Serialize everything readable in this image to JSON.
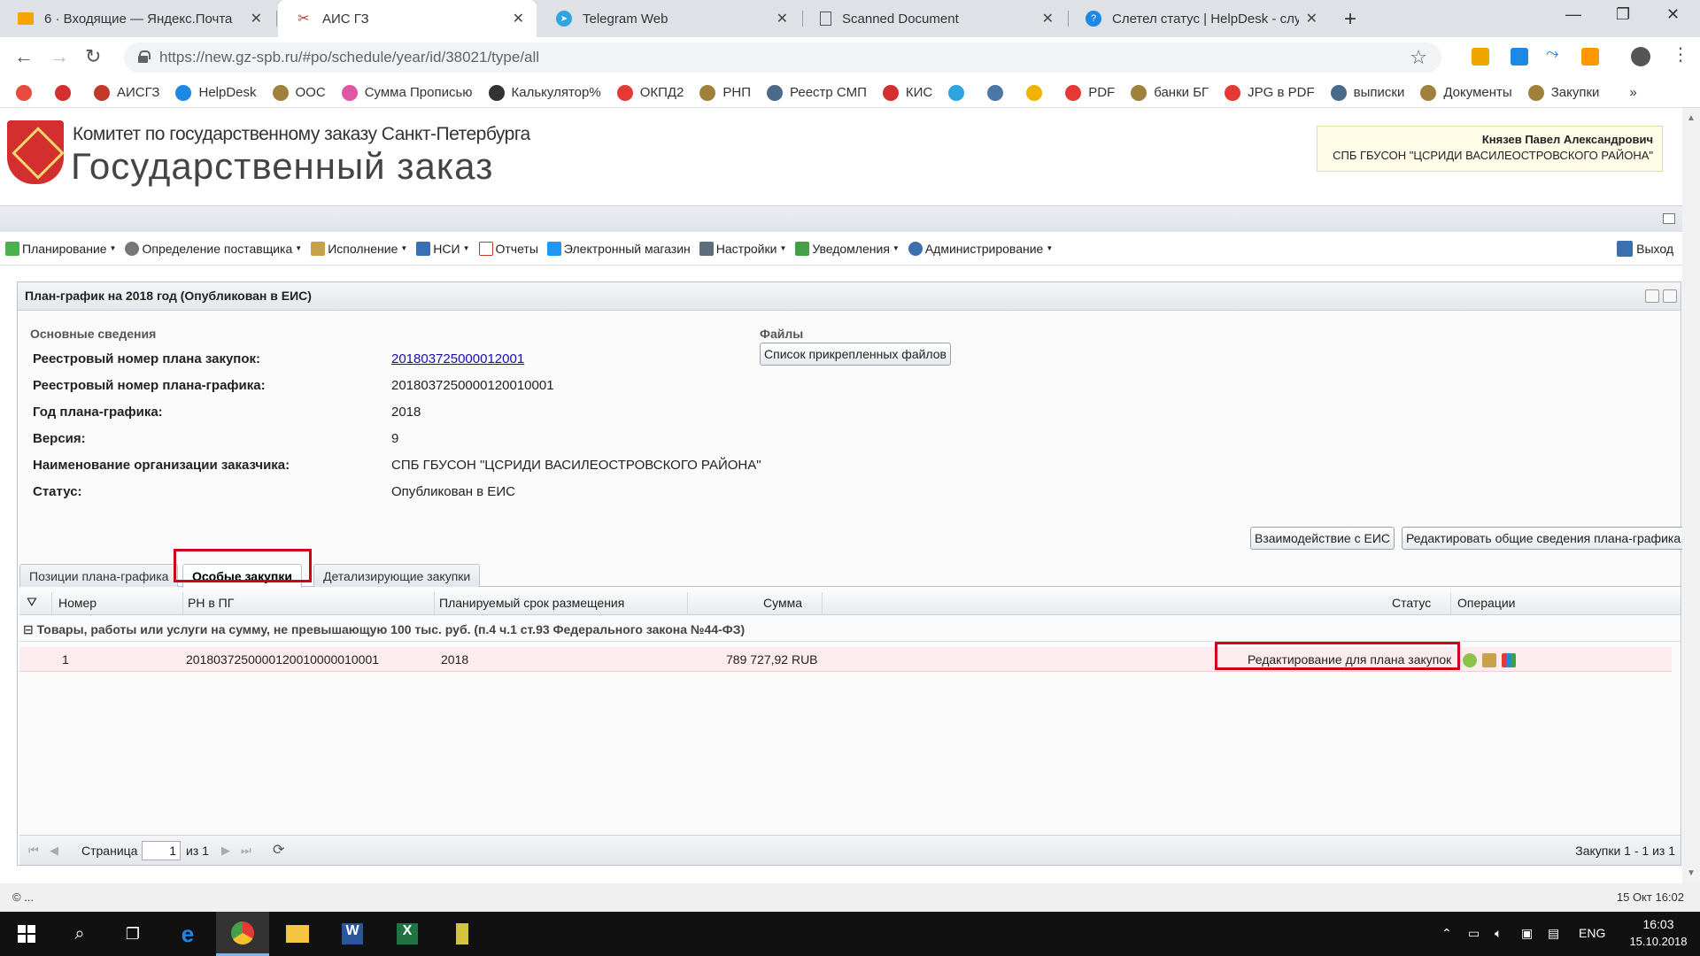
{
  "browser": {
    "tabs": [
      {
        "label": "6 · Входящие — Яндекс.Почта",
        "icon": "mail-icon"
      },
      {
        "label": "АИС ГЗ",
        "icon": "tools-icon"
      },
      {
        "label": "Telegram Web",
        "icon": "telegram-icon"
      },
      {
        "label": "Scanned Document",
        "icon": "document-icon"
      },
      {
        "label": "Слетел статус | HelpDesk - служ",
        "icon": "helpdesk-icon"
      }
    ],
    "url": "https://new.gz-spb.ru/#po/schedule/year/id/38021/type/all"
  },
  "bookmarks": [
    {
      "label": "",
      "color": "#e74c3c"
    },
    {
      "label": "",
      "color": "#d32f2f"
    },
    {
      "label": "АИСГЗ",
      "color": "#c0392b"
    },
    {
      "label": "HelpDesk",
      "color": "#1e88e5"
    },
    {
      "label": "ООС",
      "color": "#a0813c"
    },
    {
      "label": "Сумма Прописью",
      "color": "#e056a5"
    },
    {
      "label": "Калькулятор%",
      "color": "#333333"
    },
    {
      "label": "ОКПД2",
      "color": "#e53935"
    },
    {
      "label": "РНП",
      "color": "#a0813c"
    },
    {
      "label": "Реестр СМП",
      "color": "#4b6a8a"
    },
    {
      "label": "КИС",
      "color": "#d32f2f"
    },
    {
      "label": "",
      "color": "#2ca5e0"
    },
    {
      "label": "",
      "color": "#4a76a8"
    },
    {
      "label": "",
      "color": "#f0b400"
    },
    {
      "label": "PDF",
      "color": "#e53935"
    },
    {
      "label": "банки БГ",
      "color": "#a0813c"
    },
    {
      "label": "JPG в PDF",
      "color": "#e53935"
    },
    {
      "label": "выписки",
      "color": "#4b6a8a"
    },
    {
      "label": "Документы",
      "color": "#a0813c"
    },
    {
      "label": "Закупки",
      "color": "#a0813c"
    }
  ],
  "header": {
    "committee": "Комитет по государственному заказу Санкт-Петербурга",
    "title": "Государственный заказ",
    "user_name": "Князев Павел Александрович",
    "user_org": "СПБ ГБУСОН \"ЦСРИДИ ВАСИЛЕОСТРОВСКОГО РАЙОНА\""
  },
  "menu": [
    {
      "label": "Планирование",
      "dropdown": true,
      "color": "#4caf50"
    },
    {
      "label": "Определение поставщика",
      "dropdown": true,
      "color": "#777777"
    },
    {
      "label": "Исполнение",
      "dropdown": true,
      "color": "#c8a24a"
    },
    {
      "label": "НСИ",
      "dropdown": true,
      "color": "#3a6fb0"
    },
    {
      "label": "Отчеты",
      "dropdown": false,
      "color": "#c0392b"
    },
    {
      "label": "Электронный магазин",
      "dropdown": false,
      "color": "#2196f3"
    },
    {
      "label": "Настройки",
      "dropdown": true,
      "color": "#5d6d7e"
    },
    {
      "label": "Уведомления",
      "dropdown": true,
      "color": "#43a047"
    },
    {
      "label": "Администрирование",
      "dropdown": true,
      "color": "#3a6fb0"
    }
  ],
  "logout_label": "Выход",
  "panel": {
    "title": "План-график на 2018 год (Опубликован в ЕИС)",
    "section_title": "Основные сведения",
    "files_title": "Файлы",
    "files_button": "Список прикрепленных файлов",
    "fields": [
      {
        "label": "Реестровый номер плана закупок:",
        "value": "201803725000012001",
        "link": true
      },
      {
        "label": "Реестровый номер плана-графика:",
        "value": "2018037250000120010001",
        "link": false
      },
      {
        "label": "Год плана-графика:",
        "value": "2018",
        "link": false
      },
      {
        "label": "Версия:",
        "value": "9",
        "link": false
      },
      {
        "label": "Наименование организации заказчика:",
        "value": "СПБ ГБУСОН \"ЦСРИДИ ВАСИЛЕОСТРОВСКОГО РАЙОНА\"",
        "link": false
      },
      {
        "label": "Статус:",
        "value": "Опубликован в ЕИС",
        "link": false
      }
    ],
    "btn_eis": "Взаимодействие с ЕИС",
    "btn_edit": "Редактировать общие сведения плана-графика",
    "tabs": [
      "Позиции плана-графика",
      "Особые закупки",
      "Детализирующие закупки"
    ],
    "active_tab": 1,
    "columns": [
      "Номер",
      "РН в ПГ",
      "Планируемый срок размещения",
      "Сумма",
      "Статус",
      "Операции"
    ],
    "group": "Товары, работы или услуги на сумму, не превышающую 100 тыс. руб. (п.4 ч.1 ст.93 Федерального закона №44-ФЗ)",
    "rows": [
      {
        "num": "1",
        "rn": "2018037250000120010000010001",
        "term": "2018",
        "sum": "789 727,92 RUB",
        "status": "Редактирование для плана закупок"
      }
    ],
    "pager": {
      "page_label": "Страница",
      "page": "1",
      "of": "из 1",
      "summary": "Закупки 1 - 1 из 1"
    }
  },
  "footer": {
    "left": "© ...",
    "right": "15 Окт 16:02"
  },
  "taskbar": {
    "lang": "ENG",
    "time": "16:03",
    "date": "15.10.2018"
  }
}
